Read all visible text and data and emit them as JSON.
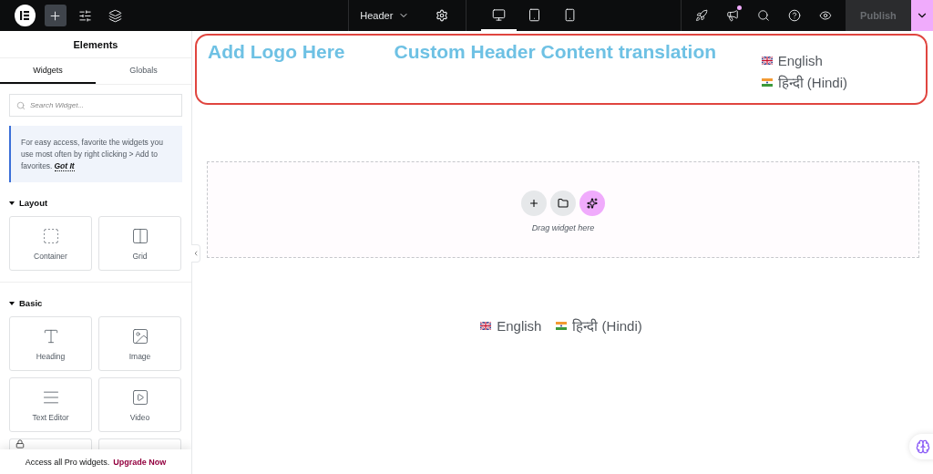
{
  "topbar": {
    "tools": [
      {
        "kind": "plus",
        "selected": true
      },
      {
        "kind": "sliders",
        "selected": false
      },
      {
        "kind": "layers",
        "selected": false
      }
    ],
    "document": {
      "label": "Header"
    },
    "devices": [
      {
        "kind": "desktop",
        "selected": true
      },
      {
        "kind": "tablet",
        "selected": false
      },
      {
        "kind": "mobile",
        "selected": false
      }
    ],
    "actions": [
      {
        "kind": "rocket",
        "notify": false
      },
      {
        "kind": "megaphone",
        "notify": true
      },
      {
        "kind": "search",
        "notify": false
      },
      {
        "kind": "help",
        "notify": false
      },
      {
        "kind": "eye",
        "notify": false
      }
    ],
    "publish": {
      "label": "Publish",
      "disabled": true
    }
  },
  "sidebar": {
    "title": "Elements",
    "tabs": [
      {
        "label": "Widgets",
        "selected": true
      },
      {
        "label": "Globals",
        "selected": false
      }
    ],
    "search": {
      "placeholder": "Search Widget..."
    },
    "tip": {
      "text": "For easy access, favorite the widgets you use most often by right clicking > Add to favorites.",
      "link": "Got It"
    },
    "sections": [
      {
        "title": "Layout",
        "expanded": true,
        "widgets": [
          {
            "kind": "container",
            "label": "Container"
          },
          {
            "kind": "grid",
            "label": "Grid"
          }
        ]
      },
      {
        "title": "Basic",
        "expanded": true,
        "widgets": [
          {
            "kind": "heading",
            "label": "Heading"
          },
          {
            "kind": "image",
            "label": "Image"
          },
          {
            "kind": "text",
            "label": "Text Editor"
          },
          {
            "kind": "video",
            "label": "Video"
          },
          {
            "kind": "locked"
          },
          {
            "kind": "blank"
          }
        ]
      }
    ],
    "promo": {
      "text": "Access all Pro widgets.",
      "link": "Upgrade Now"
    }
  },
  "canvas": {
    "header": {
      "logo": "Add Logo Here",
      "title": "Custom Header Content translation",
      "languages": [
        {
          "kind": "uk",
          "label": "English"
        },
        {
          "kind": "in",
          "label": "हिन्दी (Hindi)"
        }
      ]
    },
    "dropzone": {
      "buttons": [
        {
          "kind": "plus"
        },
        {
          "kind": "folder"
        },
        {
          "kind": "sparkles"
        }
      ],
      "hint": "Drag widget here"
    },
    "switcher": [
      {
        "kind": "uk",
        "label": "English"
      },
      {
        "kind": "in",
        "label": "हिन्दी (Hindi)"
      }
    ]
  }
}
